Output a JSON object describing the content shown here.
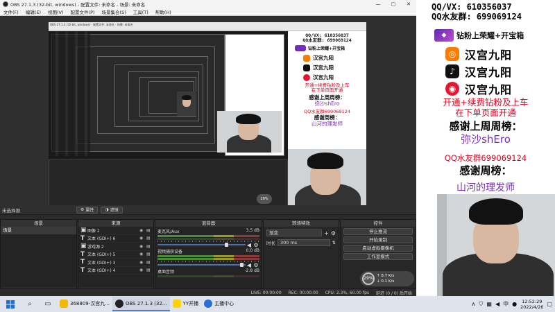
{
  "window": {
    "title": "OBS 27.1.3 (32-bit, windows) - 配置文件: 未命名 - 场景: 未命名",
    "controls": [
      "—",
      "▢",
      "✕"
    ]
  },
  "menu": [
    "文件(F)",
    "编辑(E)",
    "视图(V)",
    "配置文件(P)",
    "场景集合(S)",
    "工具(T)",
    "帮助(H)"
  ],
  "context_bar": {
    "no_source": "未选择源",
    "properties": "属性",
    "filters": "滤镜"
  },
  "docks": {
    "scenes": {
      "title": "场景",
      "items": [
        "场景"
      ]
    },
    "sources": {
      "title": "来源",
      "items": [
        {
          "type": "img",
          "label": "图像 2"
        },
        {
          "type": "T",
          "label": "文本 (GDI+) 6"
        },
        {
          "type": "img",
          "label": "游戏源 2"
        },
        {
          "type": "T",
          "label": "文本 (GDI+) 5"
        },
        {
          "type": "T",
          "label": "文本 (GDI+) 3"
        },
        {
          "type": "T",
          "label": "文本 (GDI+) 4"
        }
      ]
    },
    "mixer": {
      "title": "混音器",
      "channels": [
        {
          "name": "麦克风/Aux",
          "db": "3.5 dB"
        },
        {
          "name": "视频捕获设备",
          "db": "0.0 dB"
        },
        {
          "name": "桌面音频",
          "db": "-2.8 dB"
        }
      ]
    },
    "transitions": {
      "title": "转场特效",
      "type": "渐变",
      "duration_label": "时长",
      "duration_value": "300 ms"
    },
    "controls": {
      "title": "控件",
      "buttons": [
        "停止推流",
        "开始录制",
        "启动虚拟摄像机",
        "工作室模式"
      ]
    }
  },
  "status": {
    "live": "LIVE: 00:00:00",
    "rec": "REC: 00:00:00",
    "cpu": "CPU: 2.3%, 60.00 fps",
    "dropped": "延迟 (0 / 0) 后开始"
  },
  "perf": {
    "percent": "29%",
    "up": "8.7",
    "down": "0.1",
    "unit": "K/s"
  },
  "taskbar": {
    "tasks": [
      {
        "label": "368809-汉宫九...",
        "active": false
      },
      {
        "label": "OBS 27.1.3 (32...",
        "active": true
      },
      {
        "label": "YY开播",
        "active": false
      },
      {
        "label": "主播中心",
        "active": false
      }
    ],
    "ime": "中",
    "time": "12:52:29",
    "date": "2022/4/26"
  },
  "overlay": {
    "qq_vx": "QQ/VX: 610356037",
    "qq_group": "QQ水友群: 699069124",
    "diamond_text": "钻粉上荣耀+开宝箱",
    "apps": [
      {
        "name": "汉宫九阳",
        "icon": "kuaishou-icon",
        "color": "#ff7b00"
      },
      {
        "name": "汉宫九阳",
        "icon": "douyin-icon",
        "color": "#111111"
      },
      {
        "name": "汉宫九阳",
        "icon": "weibo-icon",
        "color": "#e6162d"
      }
    ],
    "promo_line1": "开通+续费钻粉及上车",
    "promo_line2": "在下单页面开通",
    "last_week_title": "感谢上周周榜：",
    "last_week_name": "弥沙shEro",
    "qq_group_red": "QQ水友群699069124",
    "this_week_title": "感谢周榜：",
    "this_week_name": "山河的理发师"
  },
  "nested_preview": {
    "title": "OBS 27.1.3 (32-bit, windows) - 配置文件: 未命名 - 场景: 未命名",
    "qq_vx": "QQ/VX: 610356037",
    "qq_group": "QQ水友群: 699069124",
    "diamond_text": "钻粉上荣耀+开宝箱",
    "app_name": "汉宫九阳",
    "promo_line1": "开通+续费钻粉及上车",
    "promo_line2": "在下单页面开通",
    "last_week_title": "感谢上周周榜：",
    "last_week_name": "弥沙shEro",
    "qq_group_red": "QQ水友群699069124",
    "this_week_title": "感谢周榜：",
    "this_week_name": "山河的理发师",
    "mini_percent": "29%"
  },
  "colors": {
    "accent_blue": "#4a7fd8",
    "promo_red": "#e0001b",
    "purple": "#7a2bbf"
  }
}
